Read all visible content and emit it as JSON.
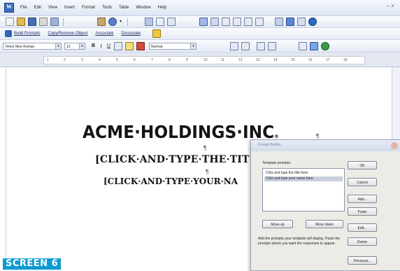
{
  "menu": {
    "items": [
      "File",
      "Edit",
      "View",
      "Insert",
      "Format",
      "Tools",
      "Table",
      "Window",
      "Help"
    ],
    "window_controls": "– ×"
  },
  "toolbar2": {
    "items": [
      "Build Prompts",
      "Copy/Remove Object",
      "Associate",
      "Dissociate"
    ]
  },
  "format_toolbar": {
    "font": "Times New Roman",
    "size": "12",
    "bold": "B",
    "italic": "I",
    "underline": "U",
    "style": "Normal"
  },
  "ruler": {
    "ticks": [
      "1",
      "2",
      "3",
      "4",
      "5",
      "6",
      "7",
      "8",
      "9",
      "10",
      "11",
      "12",
      "13",
      "14",
      "15",
      "16",
      "17",
      "18"
    ]
  },
  "document": {
    "company_name": "ACME·HOLDINGS·INC",
    "company_mark": "®",
    "pilcrow": "¶",
    "title_placeholder": "[CLICK·AND·TYPE·THE·TIT",
    "name_placeholder": "[CLICK·AND·TYPE·YOUR·NA"
  },
  "dialog": {
    "title": "Prompt Builder",
    "list_label": "Template prompts:",
    "prompts": [
      "Click and type the title here",
      "Click and type your name here"
    ],
    "buttons": {
      "ok": "OK",
      "cancel": "Cancel",
      "add": "Add...",
      "paste": "Paste",
      "edit": "Edit...",
      "delete": "Delete",
      "personal": "Personal...",
      "move_up": "Move up",
      "move_down": "Move down"
    },
    "help_text": "Add the prompts your template will display. Paste the prompts where you want the responses to appear."
  },
  "caption": "SCREEN 6",
  "colors": {
    "caption_bg": "#0a9bd1",
    "list_selection": "#c8cfdd"
  }
}
